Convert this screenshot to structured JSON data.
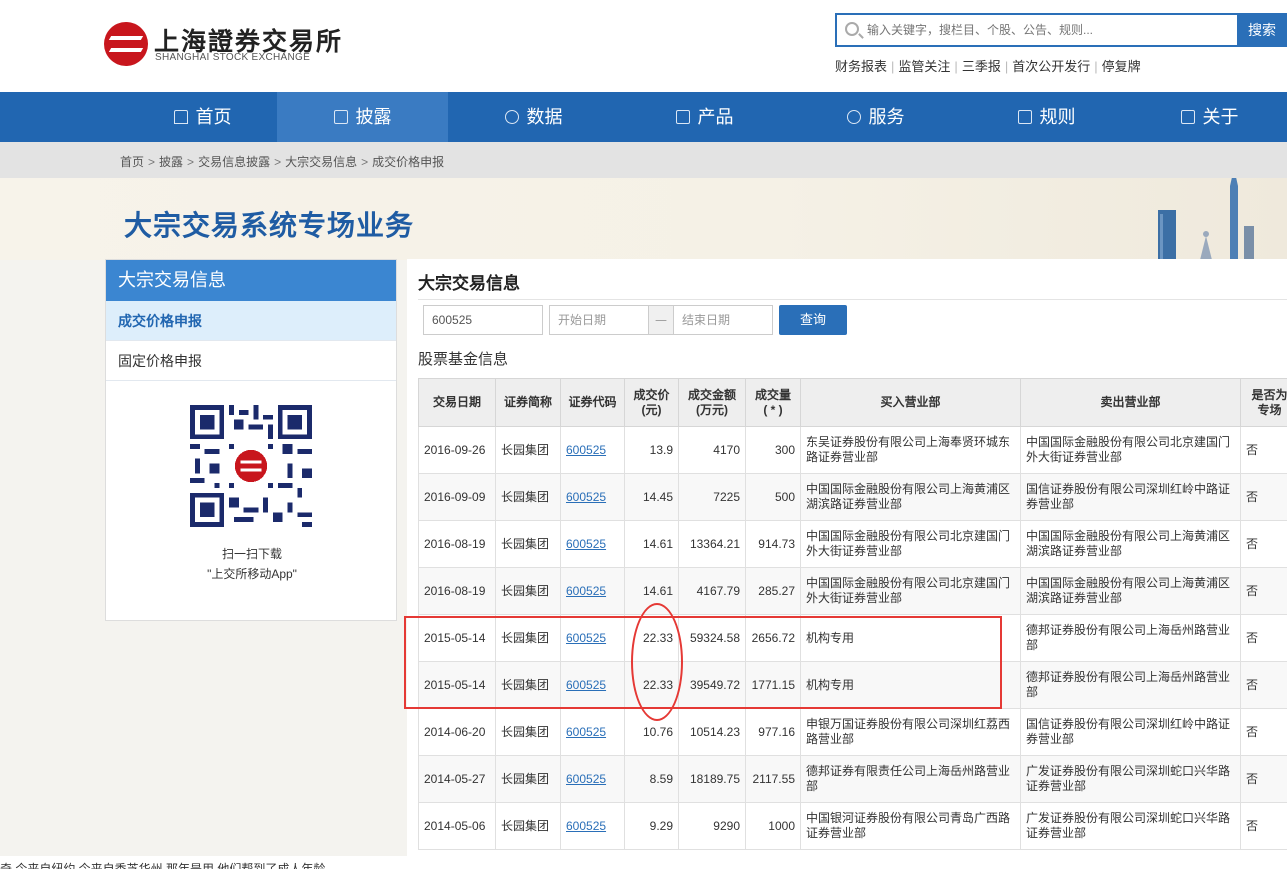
{
  "header": {
    "logo_cn": "上海證券交易所",
    "logo_en": "SHANGHAI STOCK EXCHANGE",
    "search_placeholder": "输入关键字，搜栏目、个股、公告、规则...",
    "search_button": "搜索",
    "quick_links": [
      "财务报表",
      "监管关注",
      "三季报",
      "首次公开发行",
      "停复牌"
    ]
  },
  "nav": {
    "items": [
      {
        "label": "首页",
        "icon": "home-icon"
      },
      {
        "label": "披露",
        "icon": "document-icon",
        "active": true
      },
      {
        "label": "数据",
        "icon": "chart-line-icon"
      },
      {
        "label": "产品",
        "icon": "bar-chart-icon"
      },
      {
        "label": "服务",
        "icon": "user-icon"
      },
      {
        "label": "规则",
        "icon": "scale-icon"
      },
      {
        "label": "关于",
        "icon": "square-icon"
      }
    ]
  },
  "breadcrumb": [
    "首页",
    "披露",
    "交易信息披露",
    "大宗交易信息",
    "成交价格申报"
  ],
  "page_title": "大宗交易系统专场业务",
  "sidebar": {
    "title": "大宗交易信息",
    "items": [
      {
        "label": "成交价格申报",
        "active": true
      },
      {
        "label": "固定价格申报"
      }
    ],
    "qr_caption_1": "扫一扫下载",
    "qr_caption_2": "\"上交所移动App\""
  },
  "main": {
    "title": "大宗交易信息",
    "code_value": "600525",
    "start_placeholder": "开始日期",
    "date_separator": "—",
    "end_placeholder": "结束日期",
    "query_button": "查询",
    "section_title": "股票基金信息",
    "columns": [
      "交易日期",
      "证券简称",
      "证券代码",
      "成交价\n(元)",
      "成交金额\n(万元)",
      "成交量\n( * )",
      "买入营业部",
      "卖出营业部",
      "是否为\n专场"
    ],
    "rows": [
      [
        "2016-09-26",
        "长园集团",
        "600525",
        "13.9",
        "4170",
        "300",
        "东吴证券股份有限公司上海奉贤环城东路证券营业部",
        "中国国际金融股份有限公司北京建国门外大街证券营业部",
        "否"
      ],
      [
        "2016-09-09",
        "长园集团",
        "600525",
        "14.45",
        "7225",
        "500",
        "中国国际金融股份有限公司上海黄浦区湖滨路证券营业部",
        "国信证券股份有限公司深圳红岭中路证券营业部",
        "否"
      ],
      [
        "2016-08-19",
        "长园集团",
        "600525",
        "14.61",
        "13364.21",
        "914.73",
        "中国国际金融股份有限公司北京建国门外大街证券营业部",
        "中国国际金融股份有限公司上海黄浦区湖滨路证券营业部",
        "否"
      ],
      [
        "2016-08-19",
        "长园集团",
        "600525",
        "14.61",
        "4167.79",
        "285.27",
        "中国国际金融股份有限公司北京建国门外大街证券营业部",
        "中国国际金融股份有限公司上海黄浦区湖滨路证券营业部",
        "否"
      ],
      [
        "2015-05-14",
        "长园集团",
        "600525",
        "22.33",
        "59324.58",
        "2656.72",
        "机构专用",
        "德邦证券股份有限公司上海岳州路营业部",
        "否"
      ],
      [
        "2015-05-14",
        "长园集团",
        "600525",
        "22.33",
        "39549.72",
        "1771.15",
        "机构专用",
        "德邦证券股份有限公司上海岳州路营业部",
        "否"
      ],
      [
        "2014-06-20",
        "长园集团",
        "600525",
        "10.76",
        "10514.23",
        "977.16",
        "申银万国证券股份有限公司深圳红荔西路营业部",
        "国信证券股份有限公司深圳红岭中路证券营业部",
        "否"
      ],
      [
        "2014-05-27",
        "长园集团",
        "600525",
        "8.59",
        "18189.75",
        "2117.55",
        "德邦证券有限责任公司上海岳州路营业部",
        "广发证券股份有限公司深圳蛇口兴华路证券营业部",
        "否"
      ],
      [
        "2014-05-06",
        "长园集团",
        "600525",
        "9.29",
        "9290",
        "1000",
        "中国银河证券股份有限公司青岛广西路证券营业部",
        "广发证券股份有限公司深圳蛇口兴华路证券营业部",
        "否"
      ]
    ]
  },
  "footer_text": "奇     今来自纽约     今来自秀芝华州    那年是用    他们帮到了成人年龄",
  "colors": {
    "brand_blue": "#2166b1",
    "highlight_red": "#e53935",
    "logo_red": "#c8161d"
  }
}
